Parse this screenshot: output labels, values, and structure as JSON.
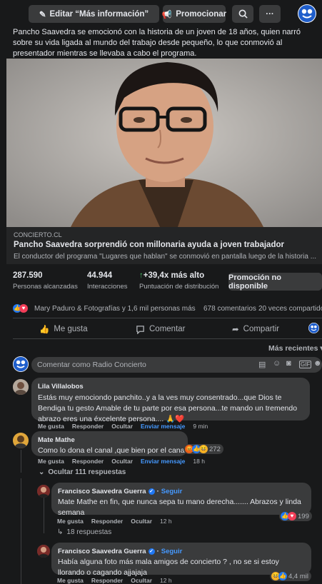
{
  "toolbar": {
    "edit_label": "Editar “Más información”",
    "promote_label": "Promocionar",
    "more_label": "···"
  },
  "post": {
    "caption": "Pancho Saavedra se emocionó con la historia de un joven de 18 años, quien narró sobre su vida ligada al mundo del trabajo desde pequeño, lo que conmovió al presentador mientras se llevaba a cabo el programa.",
    "link_domain": "CONCIERTO.CL",
    "link_title": "Pancho Saavedra sorprendió con millonaria ayuda a joven trabajador",
    "link_desc": "El conductor del programa \"Lugares que hablan\" se conmovió en pantalla luego de la historia ..."
  },
  "stats": {
    "reach_value": "287.590",
    "reach_label": "Personas alcanzadas",
    "interactions_value": "44.944",
    "interactions_label": "Interacciones",
    "distribution_value": "+39,4x más alto",
    "distribution_label": "Puntuación de distribución",
    "promo_label": "Promoción no disponible"
  },
  "reactions": {
    "summary": "Mary Paduro & Fotografías y 1,6 mil personas más",
    "comments": "678 comentarios",
    "shares": "20 veces compartido"
  },
  "actions": {
    "like": "Me gusta",
    "comment": "Comentar",
    "share": "Compartir"
  },
  "sort_label": "Más recientes",
  "comment_input_placeholder": "Comentar como Radio Concierto",
  "comments": [
    {
      "name": "Lila Villalobos",
      "text": "Estás muy emociondo panchito..y a la ves muy consentrado...que Dios te Bendiga tu gesto Amable de tu parte por esa persona...te mando un tremendo abrazo eres una éxcelente persona.... 🙏❤️",
      "like": "Me gusta",
      "reply": "Responder",
      "hide": "Ocultar",
      "send": "Enviar mensaje",
      "time": "9 min"
    },
    {
      "name": "Mate Mathe",
      "text": "Como lo dona el canal ,que bien por el canal .",
      "reactions": "272",
      "like": "Me gusta",
      "reply": "Responder",
      "hide": "Ocultar",
      "send": "Enviar mensaje",
      "time": "18 h",
      "hide_replies": "Ocultar 111 respuestas"
    }
  ],
  "replies": [
    {
      "name": "Francisco Saavedra Guerra",
      "follow": "Seguir",
      "text": "Mate Mathe en fin, que nunca sepa tu mano derecha....... Abrazos y linda semana",
      "reactions": "199",
      "like": "Me gusta",
      "reply": "Responder",
      "hide": "Ocultar",
      "time": "12 h",
      "more_replies": "18 respuestas"
    },
    {
      "name": "Francisco Saavedra Guerra",
      "follow": "Seguir",
      "text": "Había alguna foto más mala amigos de concierto ? , no se si estoy llorando o cagando ajjajaja",
      "reactions": "4,4 mil",
      "like": "Me gusta",
      "reply": "Responder",
      "hide": "Ocultar",
      "time": "12 h"
    }
  ],
  "colors": {
    "background": "#18191a",
    "card": "#242526",
    "button": "#3a3b3c",
    "link_blue": "#4599ff",
    "green_arrow": "#45bd62"
  }
}
